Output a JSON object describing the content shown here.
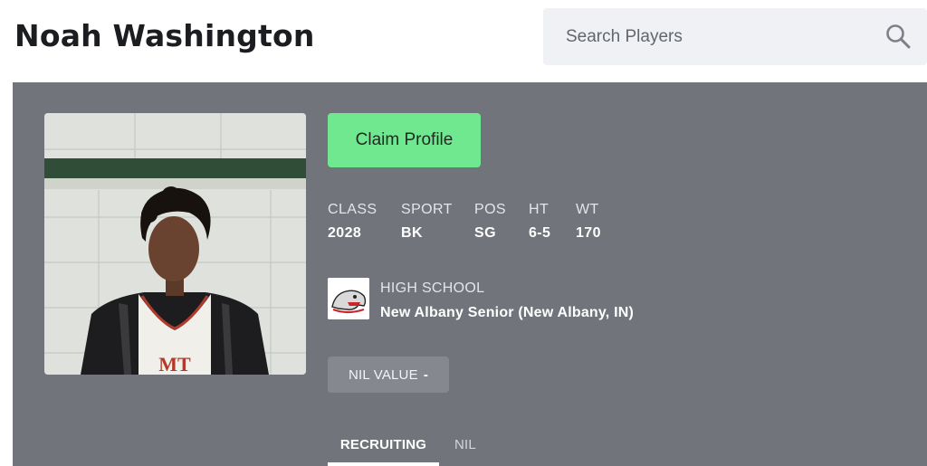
{
  "header": {
    "player_name": "Noah Washington"
  },
  "search": {
    "placeholder": "Search Players",
    "icon": "search-icon"
  },
  "profile": {
    "claim_label": "Claim Profile",
    "stats": [
      {
        "label": "CLASS",
        "value": "2028"
      },
      {
        "label": "SPORT",
        "value": "BK"
      },
      {
        "label": "POS",
        "value": "SG"
      },
      {
        "label": "HT",
        "value": "6-5"
      },
      {
        "label": "WT",
        "value": "170"
      }
    ],
    "school": {
      "label": "HIGH SCHOOL",
      "name": "New Albany Senior (New Albany, IN)",
      "logo": "bulldog-logo"
    },
    "nil": {
      "label": "NIL VALUE",
      "value": "-"
    }
  },
  "tabs": [
    {
      "label": "RECRUITING",
      "active": true
    },
    {
      "label": "NIL",
      "active": false
    }
  ],
  "colors": {
    "panel": "#71747b",
    "claim_button": "#6fe88f",
    "nil_badge": "#85888e"
  }
}
